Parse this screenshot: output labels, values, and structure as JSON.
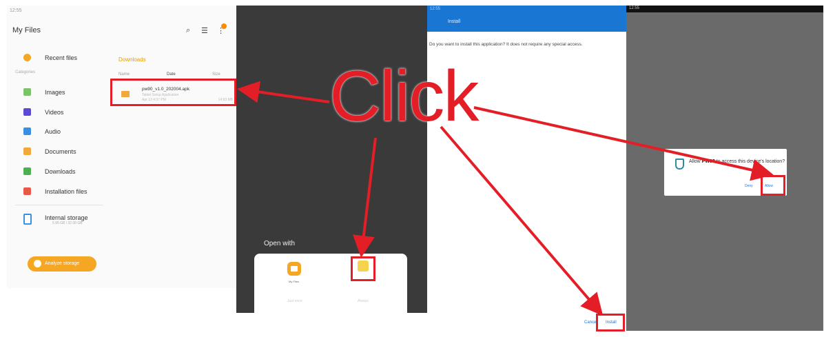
{
  "annotation": {
    "click_text": "Click"
  },
  "my_files": {
    "status_time": "12:55",
    "title": "My Files",
    "sidebar": {
      "recent": "Recent files",
      "categories_label": "Categories",
      "items": [
        {
          "label": "Images",
          "color": "#7cc26a"
        },
        {
          "label": "Videos",
          "color": "#5b4bd3"
        },
        {
          "label": "Audio",
          "color": "#3a8fe0"
        },
        {
          "label": "Documents",
          "color": "#f2a93b"
        },
        {
          "label": "Downloads",
          "color": "#4caf50"
        },
        {
          "label": "Installation files",
          "color": "#e8594a"
        }
      ],
      "storage": {
        "label": "Internal storage",
        "sub": "5.95 GB / 32.00 GB"
      },
      "analyze_button": "Analyze storage"
    },
    "content": {
      "breadcrumb": "Downloads",
      "col_name": "Name",
      "col_date": "Date",
      "col_size": "Size",
      "file": {
        "name": "pw90_v1.0_202004.apk",
        "sub": "Tablet Setup Application",
        "date": "Apr 13 4:37 PM",
        "size": "14.93 MB"
      }
    }
  },
  "open_with": {
    "title": "Open with",
    "app1_label": "My Files",
    "just_once": "Just once",
    "always": "Always"
  },
  "installer": {
    "status": "12:55",
    "app_title": "Install",
    "message": "Do you want to install this application? It does not require any special access.",
    "cancel": "Cancel",
    "install": "Install"
  },
  "permission": {
    "status": "12:55",
    "text_pre": "Allow",
    "app_name": "PW90",
    "text_post": "to access this device's location?",
    "deny": "Deny",
    "allow": "Allow"
  },
  "colors": {
    "annotation_red": "#e41e26",
    "accent_orange": "#f5a623",
    "install_blue": "#1976d2"
  }
}
